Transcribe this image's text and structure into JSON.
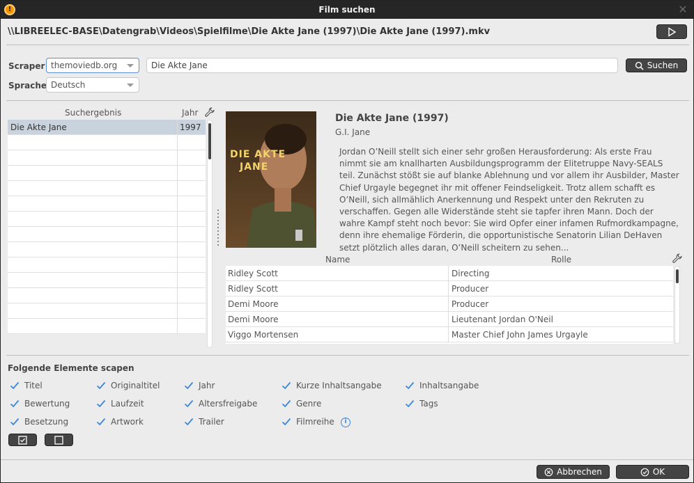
{
  "window": {
    "title": "Film suchen"
  },
  "file": {
    "path": "\\\\LIBREELEC-BASE\\Datengrab\\Videos\\Spielfilme\\Die Akte Jane (1997)\\Die Akte Jane (1997).mkv"
  },
  "search": {
    "scraper_label": "Scraper",
    "scraper_value": "themoviedb.org",
    "language_label": "Sprache",
    "language_value": "Deutsch",
    "query": "Die Akte Jane",
    "search_button": "Suchen"
  },
  "results": {
    "col_title": "Suchergebnis",
    "col_year": "Jahr",
    "rows": [
      {
        "title": "Die Akte Jane",
        "year": "1997",
        "selected": true
      }
    ]
  },
  "movie": {
    "title": "Die Akte Jane (1997)",
    "original_title": "G.I. Jane",
    "poster_text_1": "DIE AKTE",
    "poster_text_2": "JANE",
    "plot": "Jordan O’Neill stellt sich einer sehr großen Herausforderung: Als erste Frau nimmt sie am knallharten Ausbildungsprogramm der Elitetruppe Navy-SEALS teil. Zunächst stößt sie auf blanke Ablehnung und vor allem ihr Ausbilder, Master Chief Urgayle begegnet ihr mit offener Feindseligkeit. Trotz allem schafft es O’Neill, sich allmählich Anerkennung und Respekt unter den Rekruten zu verschaffen. Gegen alle Widerstände steht sie tapfer ihren Mann. Doch der wahre Kampf steht noch bevor: Sie wird Opfer einer infamen Rufmordkampagne, denn ihre ehemalige Förderin, die opportunistische Senatorin Lilian DeHaven setzt plötzlich alles daran, O’Neill scheitern zu sehen..."
  },
  "cast": {
    "col_name": "Name",
    "col_role": "Rolle",
    "rows": [
      {
        "name": "Ridley Scott",
        "role": "Directing"
      },
      {
        "name": "Ridley Scott",
        "role": "Producer"
      },
      {
        "name": "Demi Moore",
        "role": "Producer"
      },
      {
        "name": "Demi Moore",
        "role": "Lieutenant Jordan O'Neil"
      },
      {
        "name": "Viggo Mortensen",
        "role": "Master Chief John James Urgayle"
      }
    ]
  },
  "scrape": {
    "label": "Folgende Elemente scapen",
    "items": [
      {
        "label": "Titel",
        "checked": true
      },
      {
        "label": "Originaltitel",
        "checked": true
      },
      {
        "label": "Jahr",
        "checked": true
      },
      {
        "label": "Kurze Inhaltsangabe",
        "checked": true
      },
      {
        "label": "Inhaltsangabe",
        "checked": true
      },
      {
        "label": "Bewertung",
        "checked": true
      },
      {
        "label": "Laufzeit",
        "checked": true
      },
      {
        "label": "Altersfreigabe",
        "checked": true
      },
      {
        "label": "Genre",
        "checked": true
      },
      {
        "label": "Tags",
        "checked": true
      },
      {
        "label": "Besetzung",
        "checked": true
      },
      {
        "label": "Artwork",
        "checked": true
      },
      {
        "label": "Trailer",
        "checked": true
      },
      {
        "label": "Filmreihe",
        "checked": true
      }
    ]
  },
  "footer": {
    "cancel": "Abbrechen",
    "ok": "OK"
  },
  "colors": {
    "titlebar": "#262626",
    "accent": "#f29400",
    "selection": "#c9d3de",
    "check": "#3a86d8"
  }
}
